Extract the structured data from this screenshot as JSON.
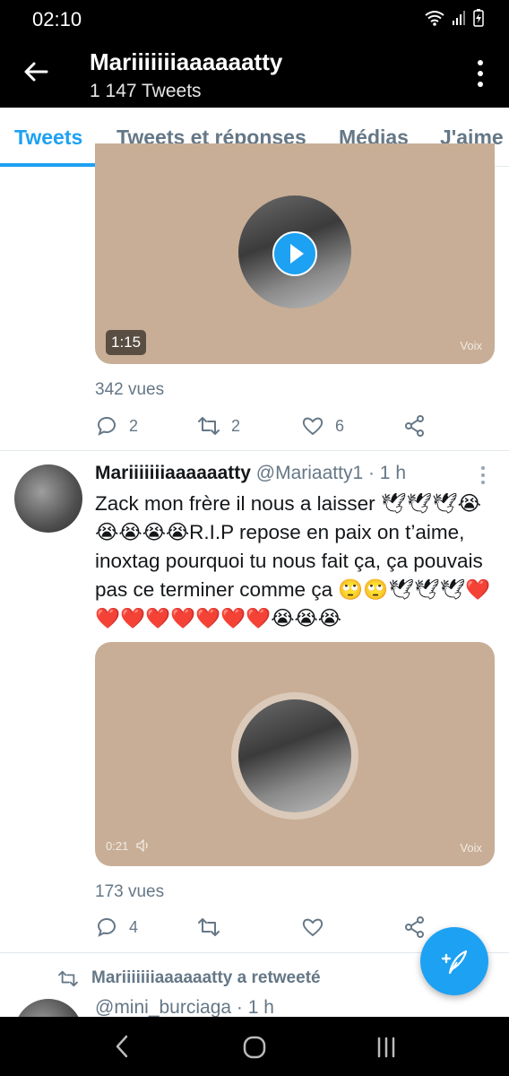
{
  "status_bar": {
    "time": "02:10"
  },
  "header": {
    "title": "Mariiiiiiiaaaaaatty",
    "subtitle": "1 147 Tweets"
  },
  "tabs": [
    {
      "label": "Tweets",
      "active": true
    },
    {
      "label": "Tweets et réponses",
      "active": false
    },
    {
      "label": "Médias",
      "active": false
    },
    {
      "label": "J'aime",
      "active": false
    }
  ],
  "tweets": [
    {
      "media": {
        "duration": "1:15",
        "label": "Voix"
      },
      "views": "342 vues",
      "replies": "2",
      "retweets": "2",
      "likes": "6"
    },
    {
      "author_name": "Mariiiiiiiaaaaaatty",
      "handle": "@Mariaatty1",
      "time": "· 1 h",
      "text": "Zack mon frère il nous a laisser 🕊🕊🕊😭😭😭😭😭R.I.P repose en paix on t’aime, inoxtag pourquoi tu nous fait ça, ça pouvais pas ce terminer comme ça 🙄🙄🕊🕊🕊❤️❤️❤️❤️❤️❤️❤️❤️😭😭😭",
      "media": {
        "duration": "0:21",
        "label": "Voix"
      },
      "views": "173 vues",
      "replies": "4",
      "retweets": "",
      "likes": ""
    }
  ],
  "retweet_notice": "Mariiiiiiiaaaaaatty a retweeté",
  "next_tweet": {
    "handle": "@mini_burciaga · 1 h"
  },
  "colors": {
    "accent": "#1da1f2",
    "media_bg": "#c8ae96",
    "muted": "#657786"
  }
}
